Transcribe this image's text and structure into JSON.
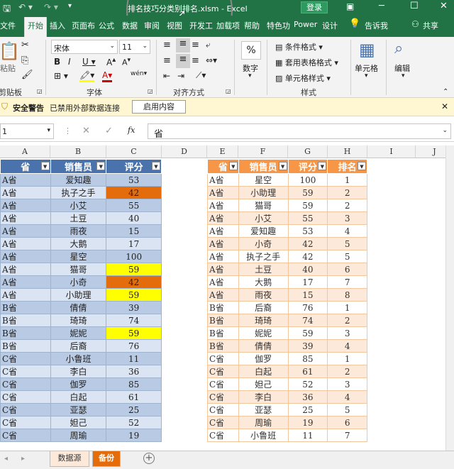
{
  "title": {
    "filename": "排名技巧分类别排名.xlsm",
    "app": "Excel",
    "login": "登录"
  },
  "tabs": [
    "文件",
    "开始",
    "插入",
    "页面布",
    "公式",
    "数据",
    "审阅",
    "视图",
    "开发工",
    "加载项",
    "帮助",
    "特色功",
    "Power",
    "设计"
  ],
  "tell_me": "告诉我",
  "share": "共享",
  "ribbon": {
    "font_name": "宋体",
    "font_size": "11",
    "paste_label": "粘贴",
    "groups": [
      "剪贴板",
      "字体",
      "对齐方式",
      "数字",
      "样式",
      "单元格",
      "编辑"
    ],
    "number_label": "数字",
    "number_icon": "%",
    "style_buttons": [
      "条件格式",
      "套用表格格式",
      "单元格样式"
    ],
    "cells_label": "单元格",
    "edit_label": "编辑"
  },
  "security": {
    "title": "安全警告",
    "message": "已禁用外部数据连接",
    "button": "启用内容"
  },
  "formula_bar": {
    "cell_ref": "1",
    "fx": "fx",
    "value": "省"
  },
  "columns": [
    "A",
    "B",
    "C",
    "D",
    "E",
    "F",
    "G",
    "H",
    "I",
    "J"
  ],
  "table_left": {
    "headers": [
      "省",
      "销售员",
      "评分"
    ],
    "rows": [
      [
        "A省",
        "爱知趣",
        "53",
        ""
      ],
      [
        "A省",
        "执子之手",
        "42",
        "orange"
      ],
      [
        "A省",
        "小艾",
        "55",
        ""
      ],
      [
        "A省",
        "土豆",
        "40",
        ""
      ],
      [
        "A省",
        "雨夜",
        "15",
        ""
      ],
      [
        "A省",
        "大鹅",
        "17",
        ""
      ],
      [
        "A省",
        "星空",
        "100",
        ""
      ],
      [
        "A省",
        "猫哥",
        "59",
        "yellow"
      ],
      [
        "A省",
        "小奇",
        "42",
        "orange"
      ],
      [
        "A省",
        "小助理",
        "59",
        "yellow"
      ],
      [
        "B省",
        "倩倩",
        "39",
        ""
      ],
      [
        "B省",
        "琦琦",
        "74",
        ""
      ],
      [
        "B省",
        "妮妮",
        "59",
        "yellow"
      ],
      [
        "B省",
        "后裔",
        "76",
        ""
      ],
      [
        "C省",
        "小鲁班",
        "11",
        ""
      ],
      [
        "C省",
        "李白",
        "36",
        ""
      ],
      [
        "C省",
        "伽罗",
        "85",
        ""
      ],
      [
        "C省",
        "白起",
        "61",
        ""
      ],
      [
        "C省",
        "亚瑟",
        "25",
        ""
      ],
      [
        "C省",
        "妲己",
        "52",
        ""
      ],
      [
        "C省",
        "周瑜",
        "19",
        ""
      ]
    ]
  },
  "table_right": {
    "headers": [
      "省",
      "销售员",
      "评分",
      "排名"
    ],
    "rows": [
      [
        "A省",
        "星空",
        "100",
        "1"
      ],
      [
        "A省",
        "小助理",
        "59",
        "2"
      ],
      [
        "A省",
        "猫哥",
        "59",
        "2"
      ],
      [
        "A省",
        "小艾",
        "55",
        "3"
      ],
      [
        "A省",
        "爱知趣",
        "53",
        "4"
      ],
      [
        "A省",
        "小奇",
        "42",
        "5"
      ],
      [
        "A省",
        "执子之手",
        "42",
        "5"
      ],
      [
        "A省",
        "土豆",
        "40",
        "6"
      ],
      [
        "A省",
        "大鹅",
        "17",
        "7"
      ],
      [
        "A省",
        "雨夜",
        "15",
        "8"
      ],
      [
        "B省",
        "后裔",
        "76",
        "1"
      ],
      [
        "B省",
        "琦琦",
        "74",
        "2"
      ],
      [
        "B省",
        "妮妮",
        "59",
        "3"
      ],
      [
        "B省",
        "倩倩",
        "39",
        "4"
      ],
      [
        "C省",
        "伽罗",
        "85",
        "1"
      ],
      [
        "C省",
        "白起",
        "61",
        "2"
      ],
      [
        "C省",
        "妲己",
        "52",
        "3"
      ],
      [
        "C省",
        "李白",
        "36",
        "4"
      ],
      [
        "C省",
        "亚瑟",
        "25",
        "5"
      ],
      [
        "C省",
        "周瑜",
        "19",
        "6"
      ],
      [
        "C省",
        "小鲁班",
        "11",
        "7"
      ]
    ]
  },
  "sheet_tabs": [
    "数据源",
    "备份"
  ],
  "colors": {
    "excel_green": "#217346",
    "blue_header": "#4a73ae",
    "orange_header": "#f79646",
    "highlight_orange": "#e46c0a",
    "highlight_yellow": "#ffff00"
  }
}
